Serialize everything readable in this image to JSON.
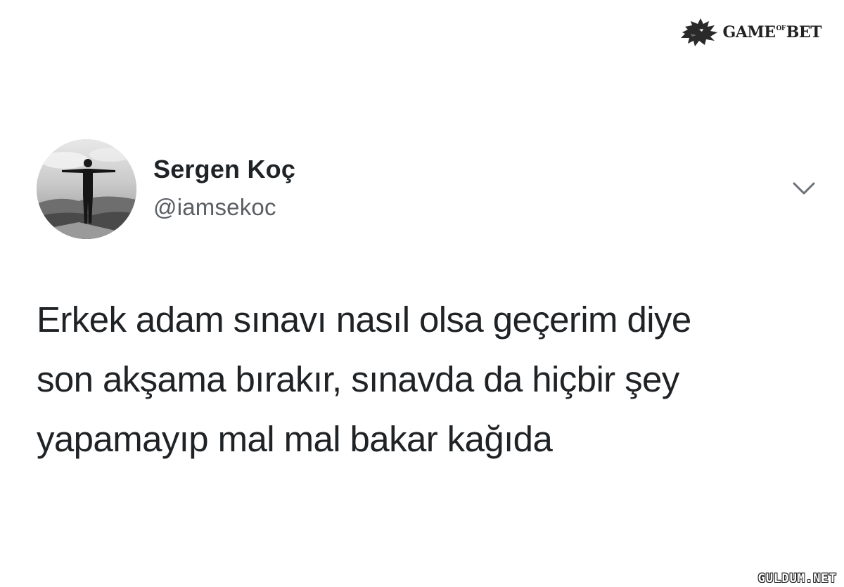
{
  "logo": {
    "prefix": "GAME",
    "middle": "OF",
    "suffix": "BET",
    "icon": "wolf-head-icon"
  },
  "tweet": {
    "author_name": "Sergen Koç",
    "author_handle": "@iamsekoc",
    "avatar_icon": "profile-photo",
    "menu_icon": "chevron-down-icon",
    "text_lines": [
      "Erkek adam sınavı nasıl olsa geçerim diye",
      "son akşama bırakır, sınavda da hiçbir şey",
      "yapamayıp mal mal bakar kağıda"
    ]
  },
  "watermark": {
    "text": "GULDUM.NET"
  },
  "colors": {
    "background": "#ffffff",
    "name": "#1f2326",
    "handle": "#5a5f64",
    "body_text": "#202326"
  }
}
